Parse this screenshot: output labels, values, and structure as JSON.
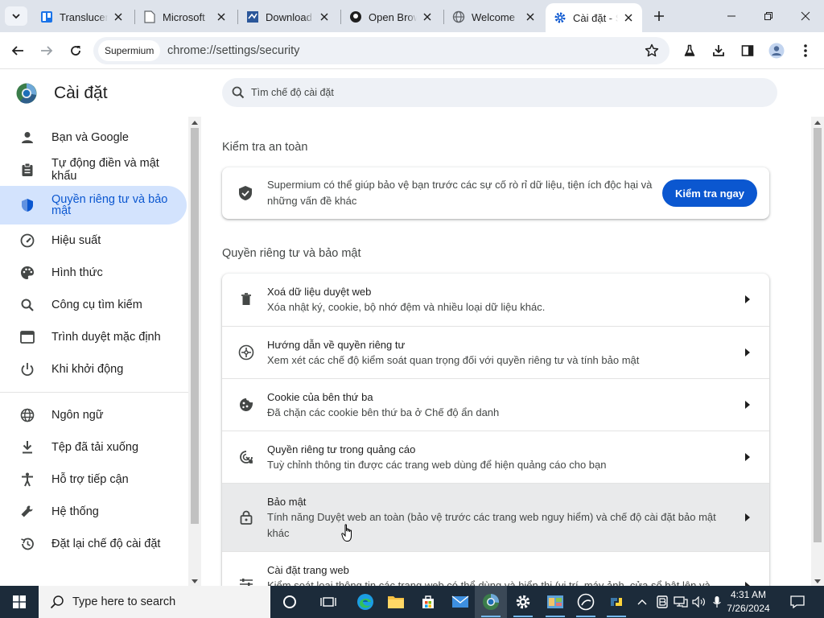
{
  "tabs": [
    {
      "title": "Translucent"
    },
    {
      "title": "Microsoft"
    },
    {
      "title": "Download"
    },
    {
      "title": "Open Brows"
    },
    {
      "title": "Welcome"
    },
    {
      "title": "Cài đặt - Supermium",
      "active": true
    }
  ],
  "toolbar": {
    "chip_label": "Supermium",
    "url": "chrome://settings/security"
  },
  "sidebar": {
    "title": "Cài đặt",
    "items": [
      {
        "label": "Bạn và Google",
        "icon": "person-icon"
      },
      {
        "label": "Tự động điền và mật khẩu",
        "icon": "clipboard-icon"
      },
      {
        "label": "Quyền riêng tư và bảo mật",
        "icon": "shield-icon",
        "active": true
      },
      {
        "label": "Hiệu suất",
        "icon": "speedometer-icon"
      },
      {
        "label": "Hình thức",
        "icon": "palette-icon"
      },
      {
        "label": "Công cụ tìm kiếm",
        "icon": "search-icon"
      },
      {
        "label": "Trình duyệt mặc định",
        "icon": "browser-icon"
      },
      {
        "label": "Khi khởi động",
        "icon": "power-icon"
      },
      {
        "label": "Ngôn ngữ",
        "icon": "globe-icon"
      },
      {
        "label": "Tệp đã tải xuống",
        "icon": "download-icon"
      },
      {
        "label": "Hỗ trợ tiếp cận",
        "icon": "accessibility-icon"
      },
      {
        "label": "Hệ thống",
        "icon": "wrench-icon"
      },
      {
        "label": "Đặt lại chế độ cài đặt",
        "icon": "history-icon"
      }
    ]
  },
  "search": {
    "placeholder": "Tìm chế độ cài đặt"
  },
  "safety_check": {
    "heading": "Kiểm tra an toàn",
    "text": "Supermium có thể giúp bảo vệ bạn trước các sự cố rò rỉ dữ liệu, tiện ích độc hại và những vấn đề khác",
    "button": "Kiểm tra ngay"
  },
  "privacy": {
    "heading": "Quyền riêng tư và bảo mật",
    "rows": [
      {
        "title": "Xoá dữ liệu duyệt web",
        "subtitle": "Xóa nhật ký, cookie, bộ nhớ đệm và nhiều loại dữ liệu khác.",
        "icon": "trash-icon"
      },
      {
        "title": "Hướng dẫn về quyền riêng tư",
        "subtitle": "Xem xét các chế độ kiểm soát quan trọng đối với quyền riêng tư và tính bảo mật",
        "icon": "compass-icon"
      },
      {
        "title": "Cookie của bên thứ ba",
        "subtitle": "Đã chặn các cookie bên thứ ba ở Chế độ ẩn danh",
        "icon": "cookie-icon"
      },
      {
        "title": "Quyền riêng tư trong quảng cáo",
        "subtitle": "Tuỳ chỉnh thông tin được các trang web dùng để hiện quảng cáo cho bạn",
        "icon": "ad-privacy-icon"
      },
      {
        "title": "Bảo mật",
        "subtitle": "Tính năng Duyệt web an toàn (bảo vệ trước các trang web nguy hiểm) và chế độ cài đặt bảo mật khác",
        "icon": "lock-icon"
      },
      {
        "title": "Cài đặt trang web",
        "subtitle": "Kiểm soát loại thông tin các trang web có thể dùng và hiển thị (vị trí, máy ảnh, cửa sổ bật lên và",
        "icon": "tune-icon"
      }
    ]
  },
  "taskbar": {
    "search_placeholder": "Type here to search",
    "time": "4:31 AM",
    "date": "7/26/2024"
  },
  "colors": {
    "accent": "#0b57d0",
    "active_nav_bg": "#d3e3fd",
    "tabstrip_bg": "#dee3eb",
    "taskbar_bg": "#1c2b3a"
  }
}
